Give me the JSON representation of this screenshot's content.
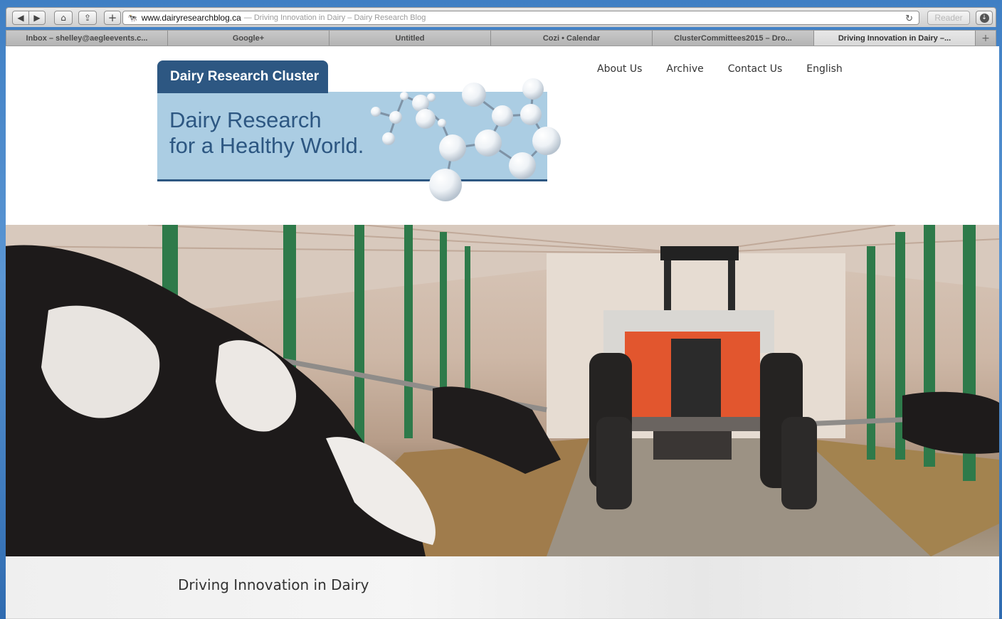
{
  "browser": {
    "url": "www.dairyresearchblog.ca",
    "page_title": "— Driving Innovation in Dairy – Dairy Research Blog",
    "reader_label": "Reader",
    "back_glyph": "◀",
    "forward_glyph": "▶",
    "home_glyph": "⌂",
    "share_glyph": "⇪",
    "add_glyph": "+",
    "reload_glyph": "↻",
    "download_glyph": "↓",
    "favicon_glyph": "🐄",
    "new_tab_glyph": "+",
    "tabs": [
      {
        "label": "Inbox – shelley@aegleevents.c..."
      },
      {
        "label": "Google+"
      },
      {
        "label": "Untitled"
      },
      {
        "label": "Cozi • Calendar"
      },
      {
        "label": "ClusterCommittees2015 – Dro..."
      },
      {
        "label": "Driving Innovation in Dairy –..."
      }
    ],
    "active_tab_index": 5
  },
  "site": {
    "logo": {
      "tab_text": "Dairy Research Cluster",
      "line1": "Dairy Research",
      "line2": "for a Healthy World.",
      "colors": {
        "dark_blue": "#2d5782",
        "light_blue": "#abcde3"
      }
    },
    "nav": {
      "about": "About Us",
      "archive": "Archive",
      "contact": "Contact Us",
      "language": "English"
    },
    "hero": {
      "caption": "Driving Innovation in Dairy"
    }
  }
}
